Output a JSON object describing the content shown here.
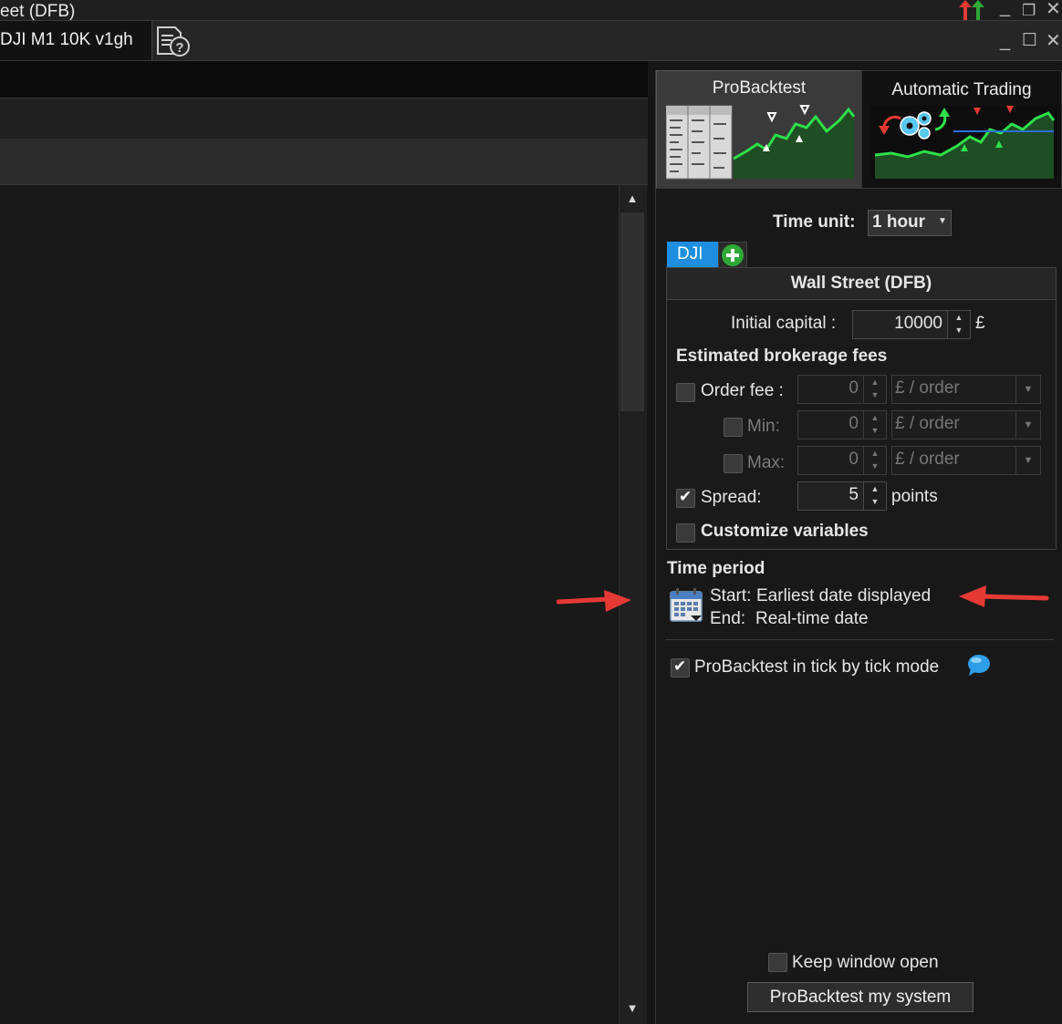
{
  "window": {
    "title": "eet (DFB)",
    "strategy_tab": "DJI M1 10K v1gh"
  },
  "panel": {
    "tabs": [
      {
        "label": "ProBacktest"
      },
      {
        "label": "Automatic Trading"
      }
    ],
    "time_unit_label": "Time unit:",
    "time_unit_value": "1 hour",
    "instrument_tab": "DJI",
    "instrument_name": "Wall Street (DFB)",
    "initial_capital_label": "Initial capital :",
    "initial_capital_value": "10000",
    "currency": "£",
    "fees_heading": "Estimated brokerage fees",
    "order_fee": {
      "label": "Order fee :",
      "value": "0",
      "unit": "£ / order",
      "checked": false
    },
    "min": {
      "label": "Min:",
      "value": "0",
      "unit": "£ / order",
      "checked": false
    },
    "max": {
      "label": "Max:",
      "value": "0",
      "unit": "£ / order",
      "checked": false
    },
    "spread": {
      "label": "Spread:",
      "value": "5",
      "unit": "points",
      "checked": true
    },
    "customize_label": "Customize variables",
    "time_period_heading": "Time period",
    "start_label": "Start:",
    "start_value": "Earliest date displayed",
    "end_label": "End:",
    "end_value": "Real-time date",
    "tick_mode_label": "ProBacktest in tick by tick mode",
    "keep_open_label": "Keep window open",
    "run_button": "ProBacktest my system"
  },
  "colors": {
    "accent_blue": "#1e8fe0",
    "add_green": "#2ea836",
    "annotation_red": "#e53935"
  },
  "icons": [
    "help-document-icon",
    "calendar-icon",
    "add-icon",
    "chat-bubble-icon",
    "gears-icon",
    "chevron-down-icon",
    "scroll-up-icon",
    "scroll-down-icon"
  ]
}
